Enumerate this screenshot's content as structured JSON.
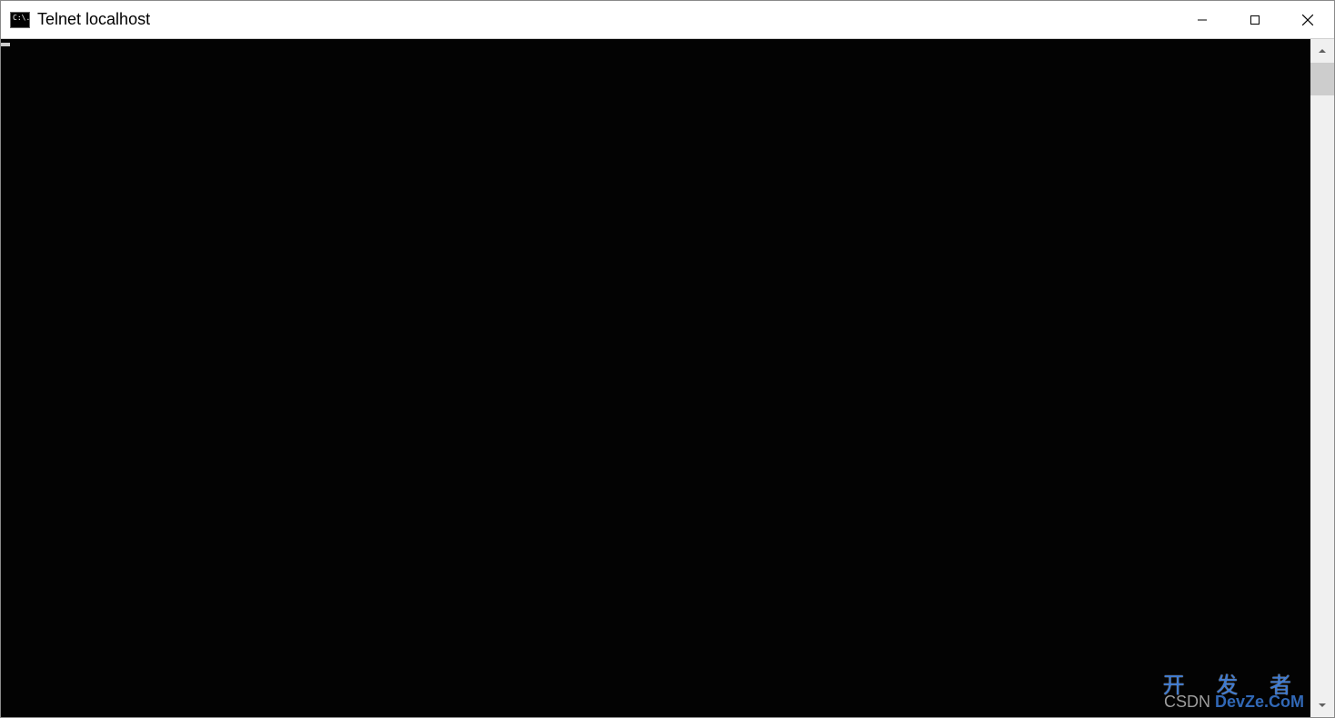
{
  "window": {
    "title": "Telnet localhost",
    "icon_name": "cmd-icon",
    "icon_glyph": "C:\\."
  },
  "terminal": {
    "content": "",
    "cursor_visible": true
  },
  "watermark": {
    "line1": "开 发 者",
    "line2_prefix": "CSDN ",
    "line2_brand": "DevZe.CoM"
  }
}
